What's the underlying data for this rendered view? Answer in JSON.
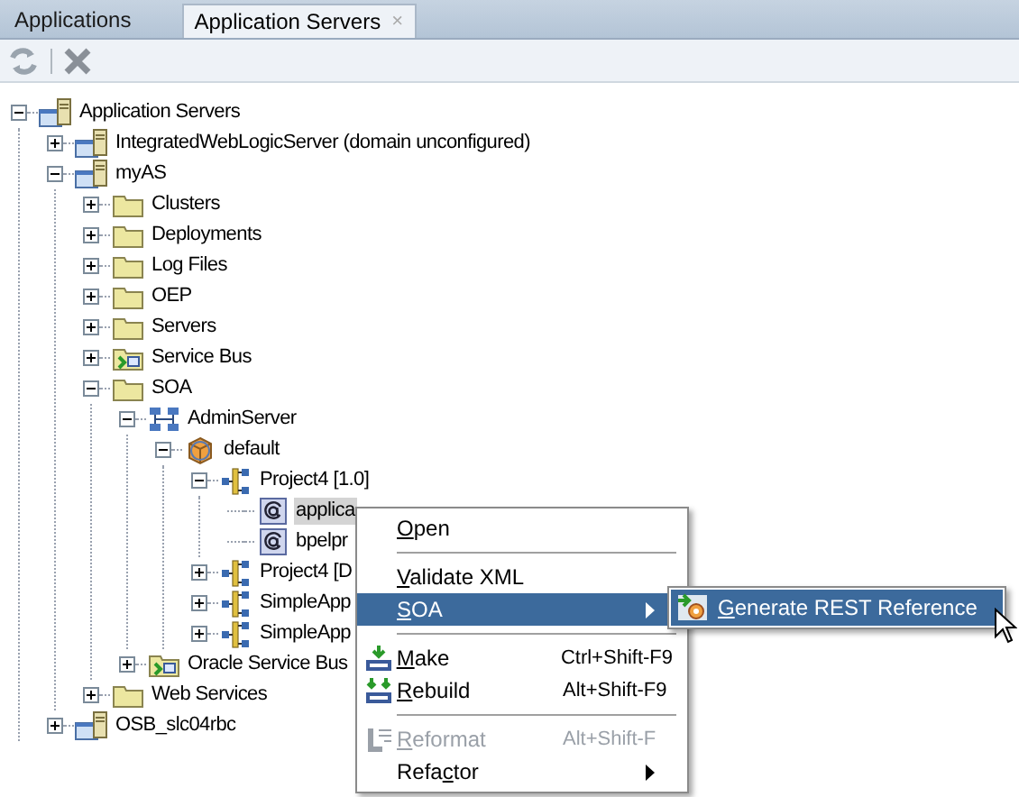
{
  "tabs": [
    {
      "label": "Applications",
      "selected": false
    },
    {
      "label": "Application Servers",
      "selected": true,
      "close": "×"
    }
  ],
  "toolbar": {
    "refresh_disabled": true,
    "delete_disabled": true
  },
  "tree": [
    {
      "label": "Application Servers",
      "kind": "server",
      "expanded": true,
      "selected": false,
      "children": [
        {
          "label": "IntegratedWebLogicServer (domain unconfigured)",
          "kind": "server",
          "expanded": false,
          "selected": false
        },
        {
          "label": "myAS",
          "kind": "server",
          "expanded": true,
          "selected": false,
          "children": [
            {
              "label": "Clusters",
              "kind": "folder",
              "expanded": false,
              "selected": false
            },
            {
              "label": "Deployments",
              "kind": "folder",
              "expanded": false,
              "selected": false
            },
            {
              "label": "Log Files",
              "kind": "folder",
              "expanded": false,
              "selected": false
            },
            {
              "label": "OEP",
              "kind": "folder",
              "expanded": false,
              "selected": false
            },
            {
              "label": "Servers",
              "kind": "folder",
              "expanded": false,
              "selected": false
            },
            {
              "label": "Service Bus",
              "kind": "bus",
              "expanded": false,
              "selected": false
            },
            {
              "label": "SOA",
              "kind": "folder",
              "expanded": true,
              "selected": false,
              "children": [
                {
                  "label": "AdminServer",
                  "kind": "cluster",
                  "expanded": true,
                  "selected": false,
                  "children": [
                    {
                      "label": "default",
                      "kind": "partition",
                      "expanded": true,
                      "selected": false,
                      "children": [
                        {
                          "label": "Project4 [1.0]",
                          "kind": "composite",
                          "expanded": true,
                          "selected": false,
                          "children": [
                            {
                              "label": "applica",
                              "kind": "wsdl",
                              "selected": true
                            },
                            {
                              "label": "bpelpr",
                              "kind": "wsdl",
                              "selected": false
                            }
                          ]
                        },
                        {
                          "label": "Project4 [D",
                          "kind": "composite",
                          "expanded": false,
                          "selected": false
                        },
                        {
                          "label": "SimpleApp",
                          "kind": "composite",
                          "expanded": false,
                          "selected": false
                        },
                        {
                          "label": "SimpleApp",
                          "kind": "composite",
                          "expanded": false,
                          "selected": false
                        }
                      ]
                    }
                  ]
                },
                {
                  "label": "Oracle Service Bus",
                  "kind": "bus",
                  "expanded": false,
                  "selected": false
                }
              ]
            },
            {
              "label": "Web Services",
              "kind": "folder",
              "expanded": false,
              "selected": false
            }
          ]
        },
        {
          "label": "OSB_slc04rbc",
          "kind": "server",
          "expanded": false,
          "selected": false
        }
      ]
    }
  ],
  "context_menu": [
    {
      "kind": "item",
      "label": "Open",
      "selected": false,
      "disabled": false
    },
    {
      "kind": "separator"
    },
    {
      "kind": "item",
      "label": "Validate XML",
      "selected": false,
      "disabled": false
    },
    {
      "kind": "submenu",
      "label": "SOA",
      "selected": true,
      "disabled": false
    },
    {
      "kind": "separator"
    },
    {
      "kind": "item",
      "label": "Make",
      "shortcut": "Ctrl+Shift-F9",
      "selected": false,
      "disabled": false
    },
    {
      "kind": "item",
      "label": "Rebuild",
      "shortcut": "Alt+Shift-F9",
      "selected": false,
      "disabled": false
    },
    {
      "kind": "separator"
    },
    {
      "kind": "item",
      "label": "Reformat",
      "shortcut": "Alt+Shift-F",
      "selected": false,
      "disabled": true
    },
    {
      "kind": "submenu",
      "label": "Refactor",
      "selected": false,
      "disabled": false
    }
  ],
  "submenu": [
    {
      "label": "Generate REST Reference",
      "selected": true
    }
  ]
}
